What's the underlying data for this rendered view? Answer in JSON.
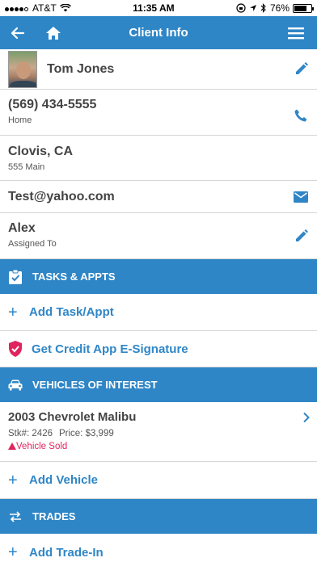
{
  "status": {
    "carrier": "AT&T",
    "time": "11:35 AM",
    "battery": "76%",
    "battery_level": 0.76
  },
  "nav": {
    "title": "Client Info"
  },
  "client": {
    "name": "Tom Jones",
    "phone": "(569) 434-5555",
    "phone_type": "Home",
    "city": "Clovis, CA",
    "street": "555 Main",
    "email": "Test@yahoo.com",
    "assignee": "Alex",
    "assignee_label": "Assigned To"
  },
  "tasks": {
    "header": "TASKS & APPTS",
    "add_label": "Add Task/Appt",
    "credit_label": "Get Credit App E-Signature"
  },
  "vehicles": {
    "header": "VEHICLES OF INTEREST",
    "items": [
      {
        "name": "2003 Chevrolet Malibu",
        "stock": "Stk#: 2426",
        "price": "Price: $3,999",
        "status": "Vehicle Sold"
      }
    ],
    "add_label": "Add Vehicle"
  },
  "trades": {
    "header": "TRADES",
    "add_label": "Add Trade-In"
  },
  "colors": {
    "accent": "#2f86c6",
    "sold": "#e0245e"
  }
}
